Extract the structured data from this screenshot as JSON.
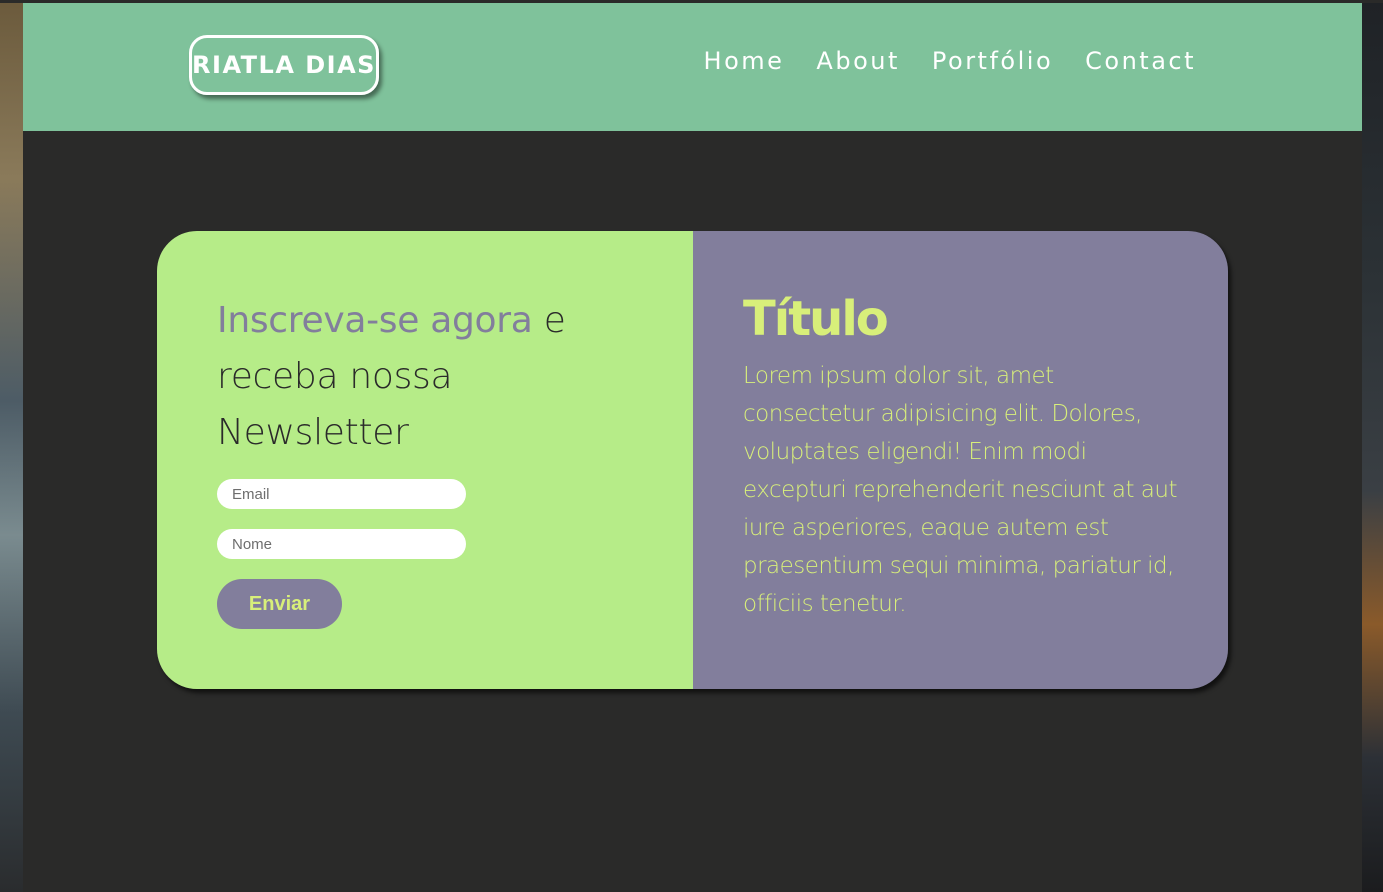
{
  "colors": {
    "header_bg": "#7fc29b",
    "page_bg": "#2a2a29",
    "card_left_bg": "#b6ec88",
    "card_right_bg": "#827e9c",
    "accent_text": "#d8ef7a",
    "headline_accent": "#827e9c"
  },
  "header": {
    "logo": "RIATLA DIAS",
    "nav": [
      {
        "label": "Home"
      },
      {
        "label": "About"
      },
      {
        "label": "Portfólio"
      },
      {
        "label": "Contact"
      }
    ]
  },
  "newsletter": {
    "headline_accent": "Inscreva-se agora",
    "headline_rest": " e receba nossa Newsletter",
    "email_placeholder": "Email",
    "name_placeholder": "Nome",
    "submit_label": "Enviar"
  },
  "info": {
    "title": "Título",
    "body": "Lorem ipsum dolor sit, amet consectetur adipisicing elit. Dolores, voluptates eligendi! Enim modi excepturi reprehenderit nesciunt at aut iure asperiores, eaque autem est praesentium sequi minima, pariatur id, officiis tenetur."
  }
}
